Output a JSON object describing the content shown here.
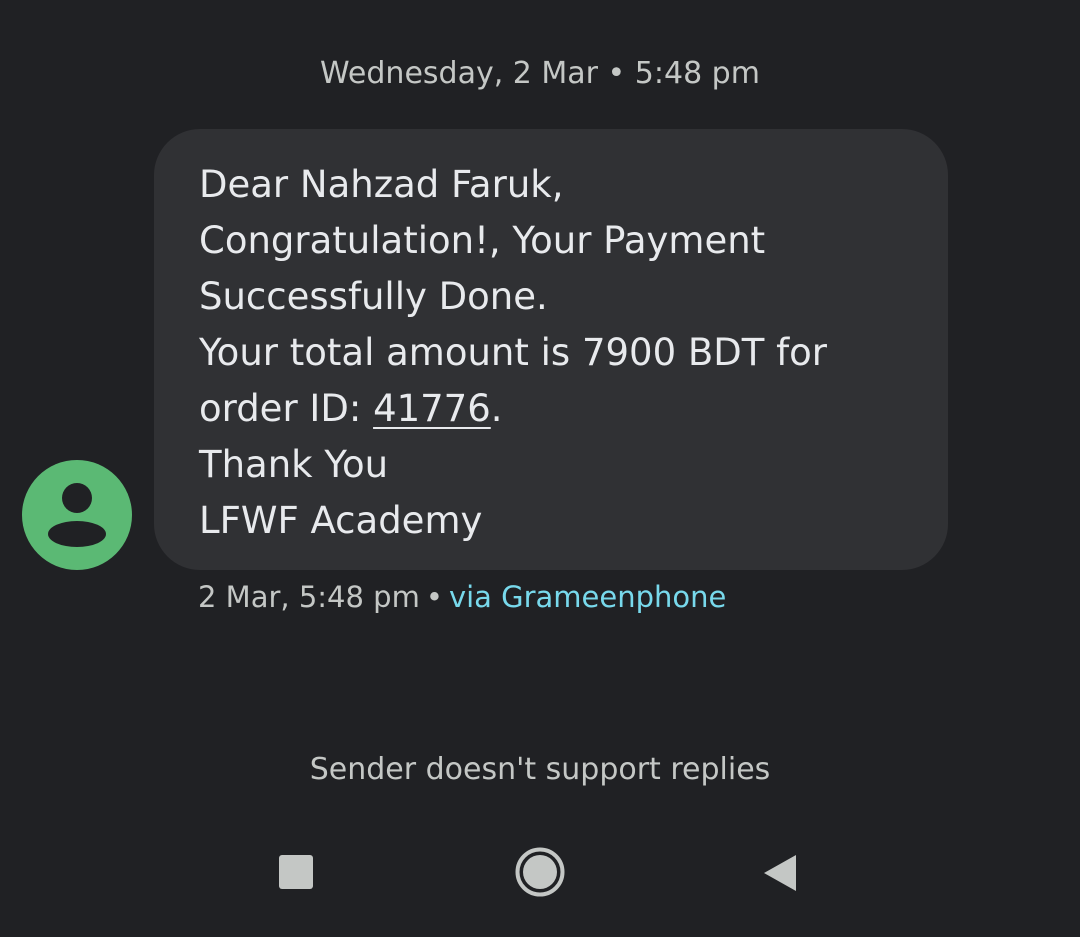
{
  "colors": {
    "background": "#202124",
    "bubble": "#303134",
    "avatar": "#5bb974",
    "link": "#78d9ec"
  },
  "date_header": "Wednesday, 2 Mar • 5:48 pm",
  "sender": {
    "avatar_icon": "person-icon"
  },
  "message": {
    "line1": "Dear Nahzad Faruk,",
    "line2": "Congratulation!, Your Payment",
    "line3": "Successfully Done.",
    "line4": "Your total amount is 7900 BDT for",
    "line5_prefix": "order ID: ",
    "order_id": "41776",
    "line5_suffix": ".",
    "line6": "Thank You",
    "line7": "LFWF Academy"
  },
  "meta": {
    "timestamp": "2 Mar, 5:48 pm",
    "separator": "•",
    "carrier": "via Grameenphone"
  },
  "footer_notice": "Sender doesn't support replies",
  "navbar": {
    "recents_icon": "square-icon",
    "home_icon": "circle-icon",
    "back_icon": "triangle-icon"
  }
}
